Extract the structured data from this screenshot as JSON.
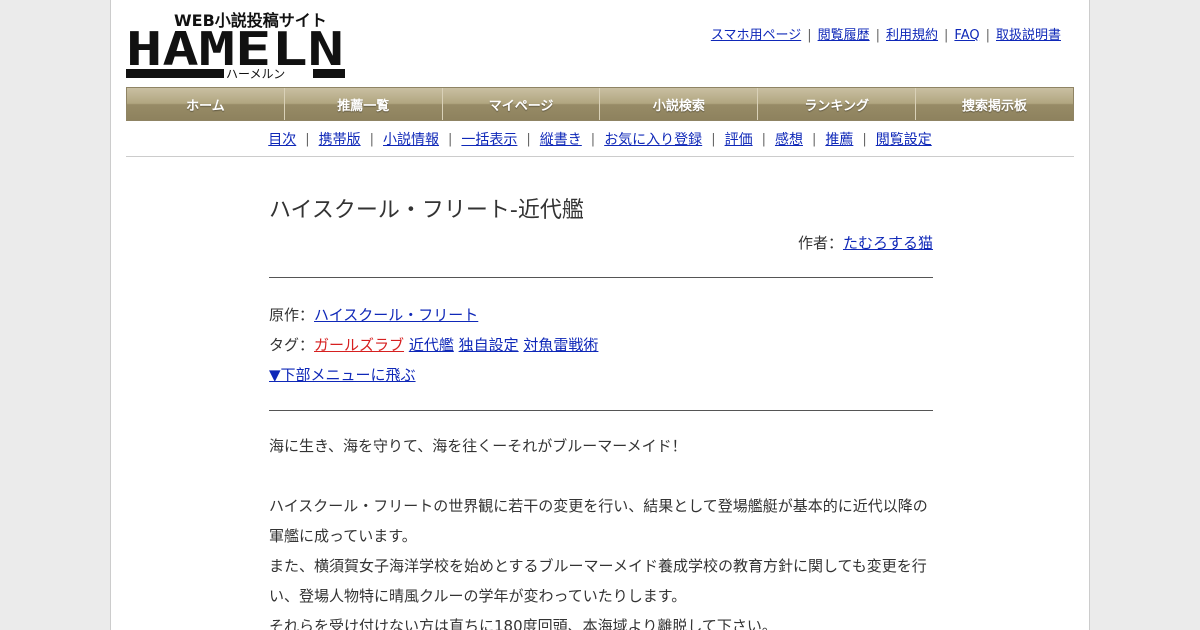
{
  "logo": {
    "tagline": "WEB小説投稿サイト",
    "wordmark": "HAMELN",
    "kana": "ハーメルン"
  },
  "toplinks": [
    "スマホ用ページ",
    "閲覧履歴",
    "利用規約",
    "FAQ",
    "取扱説明書"
  ],
  "gnav": [
    "ホーム",
    "推薦一覧",
    "マイページ",
    "小説検索",
    "ランキング",
    "捜索掲示板"
  ],
  "subnav": [
    "目次",
    "携帯版",
    "小説情報",
    "一括表示",
    "縦書き",
    "お気に入り登録",
    "評価",
    "感想",
    "推薦",
    "閲覧設定"
  ],
  "novel": {
    "title": "ハイスクール・フリート-近代艦",
    "author_label": "作者：",
    "author": "たむろする猫",
    "original_label": "原作：",
    "original": "ハイスクール・フリート",
    "tags_label": "タグ：",
    "tags": [
      "ガールズラブ",
      "近代艦",
      "独自設定",
      "対魚雷戦術"
    ],
    "jump_link": "▼下部メニューに飛ぶ"
  },
  "synopsis": [
    "海に生き、海を守りて、海を往くーそれがブルーマーメイド！",
    "",
    "ハイスクール・フリートの世界観に若干の変更を行い、結果として登場艦艇が基本的に近代以降の",
    "軍艦に成っています。",
    "また、横須賀女子海洋学校を始めとするブルーマーメイド養成学校の教育方針に関しても変更を行",
    "い、登場人物特に晴風クルーの学年が変わっていたりします。",
    "それらを受け付けない方は直ちに180度回頭、本海域より離脱して下さい。"
  ],
  "colors": {
    "link": "#0f28b8",
    "tag_highlight": "#d62020",
    "nav_bar": "#b1a680"
  }
}
